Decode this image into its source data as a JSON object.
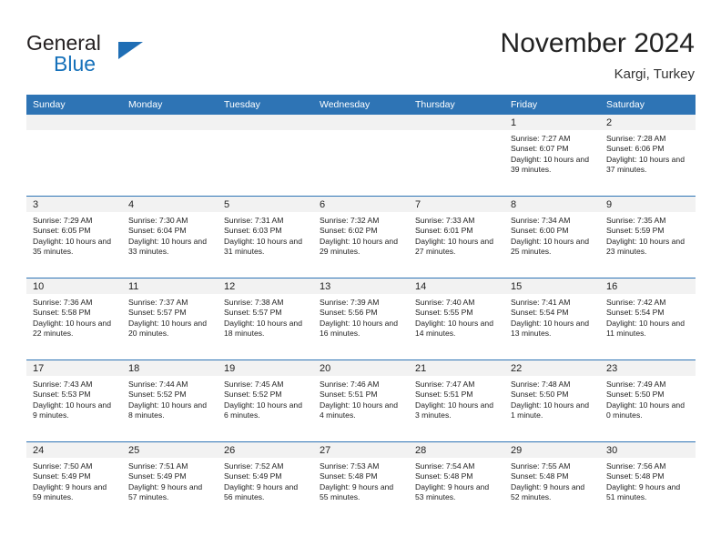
{
  "brand": {
    "word_one": "General",
    "word_two": "Blue",
    "triangle_color": "#1f6eb5",
    "blue_color": "#1671ba"
  },
  "header": {
    "title": "November 2024",
    "subtitle": "Kargi, Turkey"
  },
  "theme": {
    "header_blue": "#2e74b5",
    "daynum_band": "#f2f2f2",
    "text": "#222222"
  },
  "weekdays": [
    "Sunday",
    "Monday",
    "Tuesday",
    "Wednesday",
    "Thursday",
    "Friday",
    "Saturday"
  ],
  "weeks": [
    [
      {
        "day": "",
        "empty": true
      },
      {
        "day": "",
        "empty": true
      },
      {
        "day": "",
        "empty": true
      },
      {
        "day": "",
        "empty": true
      },
      {
        "day": "",
        "empty": true
      },
      {
        "day": "1",
        "sunrise": "Sunrise: 7:27 AM",
        "sunset": "Sunset: 6:07 PM",
        "daylight": "Daylight: 10 hours and 39 minutes."
      },
      {
        "day": "2",
        "sunrise": "Sunrise: 7:28 AM",
        "sunset": "Sunset: 6:06 PM",
        "daylight": "Daylight: 10 hours and 37 minutes."
      }
    ],
    [
      {
        "day": "3",
        "sunrise": "Sunrise: 7:29 AM",
        "sunset": "Sunset: 6:05 PM",
        "daylight": "Daylight: 10 hours and 35 minutes."
      },
      {
        "day": "4",
        "sunrise": "Sunrise: 7:30 AM",
        "sunset": "Sunset: 6:04 PM",
        "daylight": "Daylight: 10 hours and 33 minutes."
      },
      {
        "day": "5",
        "sunrise": "Sunrise: 7:31 AM",
        "sunset": "Sunset: 6:03 PM",
        "daylight": "Daylight: 10 hours and 31 minutes."
      },
      {
        "day": "6",
        "sunrise": "Sunrise: 7:32 AM",
        "sunset": "Sunset: 6:02 PM",
        "daylight": "Daylight: 10 hours and 29 minutes."
      },
      {
        "day": "7",
        "sunrise": "Sunrise: 7:33 AM",
        "sunset": "Sunset: 6:01 PM",
        "daylight": "Daylight: 10 hours and 27 minutes."
      },
      {
        "day": "8",
        "sunrise": "Sunrise: 7:34 AM",
        "sunset": "Sunset: 6:00 PM",
        "daylight": "Daylight: 10 hours and 25 minutes."
      },
      {
        "day": "9",
        "sunrise": "Sunrise: 7:35 AM",
        "sunset": "Sunset: 5:59 PM",
        "daylight": "Daylight: 10 hours and 23 minutes."
      }
    ],
    [
      {
        "day": "10",
        "sunrise": "Sunrise: 7:36 AM",
        "sunset": "Sunset: 5:58 PM",
        "daylight": "Daylight: 10 hours and 22 minutes."
      },
      {
        "day": "11",
        "sunrise": "Sunrise: 7:37 AM",
        "sunset": "Sunset: 5:57 PM",
        "daylight": "Daylight: 10 hours and 20 minutes."
      },
      {
        "day": "12",
        "sunrise": "Sunrise: 7:38 AM",
        "sunset": "Sunset: 5:57 PM",
        "daylight": "Daylight: 10 hours and 18 minutes."
      },
      {
        "day": "13",
        "sunrise": "Sunrise: 7:39 AM",
        "sunset": "Sunset: 5:56 PM",
        "daylight": "Daylight: 10 hours and 16 minutes."
      },
      {
        "day": "14",
        "sunrise": "Sunrise: 7:40 AM",
        "sunset": "Sunset: 5:55 PM",
        "daylight": "Daylight: 10 hours and 14 minutes."
      },
      {
        "day": "15",
        "sunrise": "Sunrise: 7:41 AM",
        "sunset": "Sunset: 5:54 PM",
        "daylight": "Daylight: 10 hours and 13 minutes."
      },
      {
        "day": "16",
        "sunrise": "Sunrise: 7:42 AM",
        "sunset": "Sunset: 5:54 PM",
        "daylight": "Daylight: 10 hours and 11 minutes."
      }
    ],
    [
      {
        "day": "17",
        "sunrise": "Sunrise: 7:43 AM",
        "sunset": "Sunset: 5:53 PM",
        "daylight": "Daylight: 10 hours and 9 minutes."
      },
      {
        "day": "18",
        "sunrise": "Sunrise: 7:44 AM",
        "sunset": "Sunset: 5:52 PM",
        "daylight": "Daylight: 10 hours and 8 minutes."
      },
      {
        "day": "19",
        "sunrise": "Sunrise: 7:45 AM",
        "sunset": "Sunset: 5:52 PM",
        "daylight": "Daylight: 10 hours and 6 minutes."
      },
      {
        "day": "20",
        "sunrise": "Sunrise: 7:46 AM",
        "sunset": "Sunset: 5:51 PM",
        "daylight": "Daylight: 10 hours and 4 minutes."
      },
      {
        "day": "21",
        "sunrise": "Sunrise: 7:47 AM",
        "sunset": "Sunset: 5:51 PM",
        "daylight": "Daylight: 10 hours and 3 minutes."
      },
      {
        "day": "22",
        "sunrise": "Sunrise: 7:48 AM",
        "sunset": "Sunset: 5:50 PM",
        "daylight": "Daylight: 10 hours and 1 minute."
      },
      {
        "day": "23",
        "sunrise": "Sunrise: 7:49 AM",
        "sunset": "Sunset: 5:50 PM",
        "daylight": "Daylight: 10 hours and 0 minutes."
      }
    ],
    [
      {
        "day": "24",
        "sunrise": "Sunrise: 7:50 AM",
        "sunset": "Sunset: 5:49 PM",
        "daylight": "Daylight: 9 hours and 59 minutes."
      },
      {
        "day": "25",
        "sunrise": "Sunrise: 7:51 AM",
        "sunset": "Sunset: 5:49 PM",
        "daylight": "Daylight: 9 hours and 57 minutes."
      },
      {
        "day": "26",
        "sunrise": "Sunrise: 7:52 AM",
        "sunset": "Sunset: 5:49 PM",
        "daylight": "Daylight: 9 hours and 56 minutes."
      },
      {
        "day": "27",
        "sunrise": "Sunrise: 7:53 AM",
        "sunset": "Sunset: 5:48 PM",
        "daylight": "Daylight: 9 hours and 55 minutes."
      },
      {
        "day": "28",
        "sunrise": "Sunrise: 7:54 AM",
        "sunset": "Sunset: 5:48 PM",
        "daylight": "Daylight: 9 hours and 53 minutes."
      },
      {
        "day": "29",
        "sunrise": "Sunrise: 7:55 AM",
        "sunset": "Sunset: 5:48 PM",
        "daylight": "Daylight: 9 hours and 52 minutes."
      },
      {
        "day": "30",
        "sunrise": "Sunrise: 7:56 AM",
        "sunset": "Sunset: 5:48 PM",
        "daylight": "Daylight: 9 hours and 51 minutes."
      }
    ]
  ]
}
